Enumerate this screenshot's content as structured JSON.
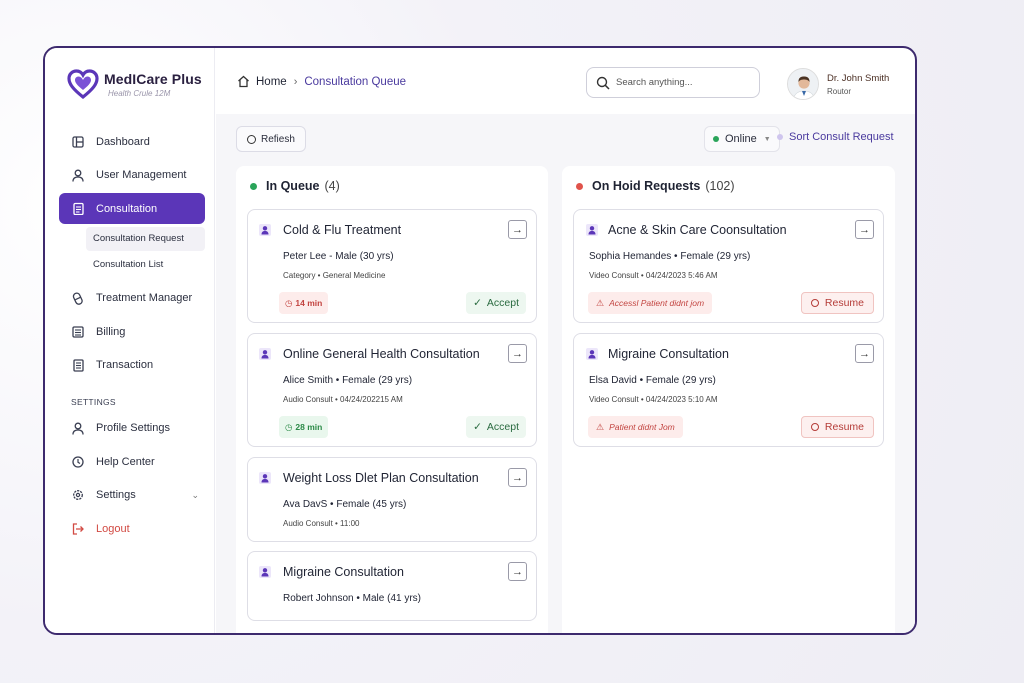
{
  "brand": {
    "name": "MedICare Plus",
    "tagline": "Health Crule 12M"
  },
  "sidebar": {
    "items": [
      {
        "label": "Dashboard",
        "icon": "dashboard-icon"
      },
      {
        "label": "User Management",
        "icon": "user-icon"
      },
      {
        "label": "Consultation",
        "icon": "clipboard-icon",
        "active": true
      },
      {
        "label": "Treatment Manager",
        "icon": "pill-icon"
      },
      {
        "label": "Billing",
        "icon": "billing-icon"
      },
      {
        "label": "Transaction",
        "icon": "transaction-icon"
      }
    ],
    "subitems": [
      {
        "label": "Consultation Request",
        "current": true
      },
      {
        "label": "Consultation List"
      }
    ],
    "settings_heading": "SETTINGS",
    "settings_items": [
      {
        "label": "Profile Settings",
        "icon": "user-icon"
      },
      {
        "label": "Help Center",
        "icon": "help-icon"
      },
      {
        "label": "Settings",
        "icon": "gear-icon"
      },
      {
        "label": "Logout",
        "icon": "logout-icon"
      }
    ]
  },
  "header": {
    "breadcrumb": {
      "home": "Home",
      "current": "Consultation Queue"
    },
    "search_placeholder": "Search anything...",
    "user": {
      "name": "Dr. John Smith",
      "role": "Routor"
    }
  },
  "toolbar": {
    "refresh_label": "Refiesh",
    "status": "Online",
    "sort_label": "Sort Consult Request"
  },
  "in_queue": {
    "title": "In Queue",
    "count": "(4)",
    "cards": [
      {
        "title": "Cold & Flu Treatment",
        "patient": "Peter Lee - Male (30 yrs)",
        "meta": "Category  •  General Medicine",
        "wait": "14 min",
        "accept": "Accept"
      },
      {
        "title": "Online General Health Consultation",
        "patient": "Alice Smith • Female (29 yrs)",
        "meta": "Audio Consult  •  04/24/202215 AM",
        "wait": "28 min",
        "accept": "Accept"
      },
      {
        "title": "Weight Loss Dlet Plan Consultation",
        "patient": "Ava DavS • Female (45 yrs)",
        "meta": "Audio Consult  •  11:00"
      },
      {
        "title": "Migraine Consultation",
        "patient": "Robert Johnson • Male (41 yrs)"
      }
    ]
  },
  "on_hold": {
    "title": "On Hoid Requests",
    "count": "(102)",
    "cards": [
      {
        "title": "Acne & Skin Care Coonsultation",
        "patient": "Sophia Hemandes • Female (29 yrs)",
        "meta": "Video Consult  •  04/24/2023   5:46 AM",
        "warning": "Accessl Patient didnt jom",
        "resume": "Resume"
      },
      {
        "title": "Migraine Consultation",
        "patient": "Elsa David • Female (29 yrs)",
        "meta": "Video Consult  •  04/24/2023   5:10 AM",
        "warning": "Patient didnt Jom",
        "resume": "Resume"
      }
    ]
  },
  "colors": {
    "accent": "#5b36b8",
    "frame": "#3d2a6e",
    "queue_dot": "#2aa45a",
    "hold_dot": "#e0534b"
  }
}
